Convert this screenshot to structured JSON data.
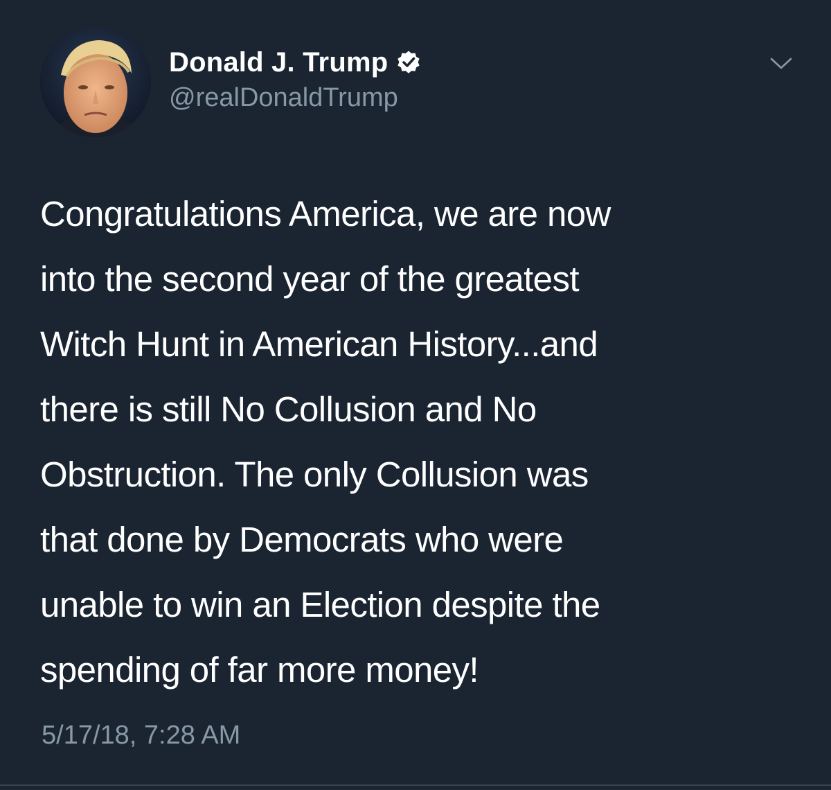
{
  "author": {
    "display_name": "Donald J. Trump",
    "handle": "@realDonaldTrump",
    "verified": true
  },
  "tweet": {
    "lines": [
      "Congratulations America, we are now",
      "into the second year of the greatest",
      "Witch Hunt in American History...and",
      "there is still No Collusion and No",
      "Obstruction. The only Collusion was",
      "that done by Democrats who were",
      "unable to win an Election despite the",
      "spending of far more money!"
    ],
    "timestamp": "5/17/18, 7:28 AM"
  },
  "icons": {
    "verified": "verified-badge-icon",
    "menu": "chevron-down-icon"
  },
  "colors": {
    "background": "#1b2532",
    "primary_text": "#ffffff",
    "secondary_text": "#8899a6",
    "divider": "#38444d"
  }
}
